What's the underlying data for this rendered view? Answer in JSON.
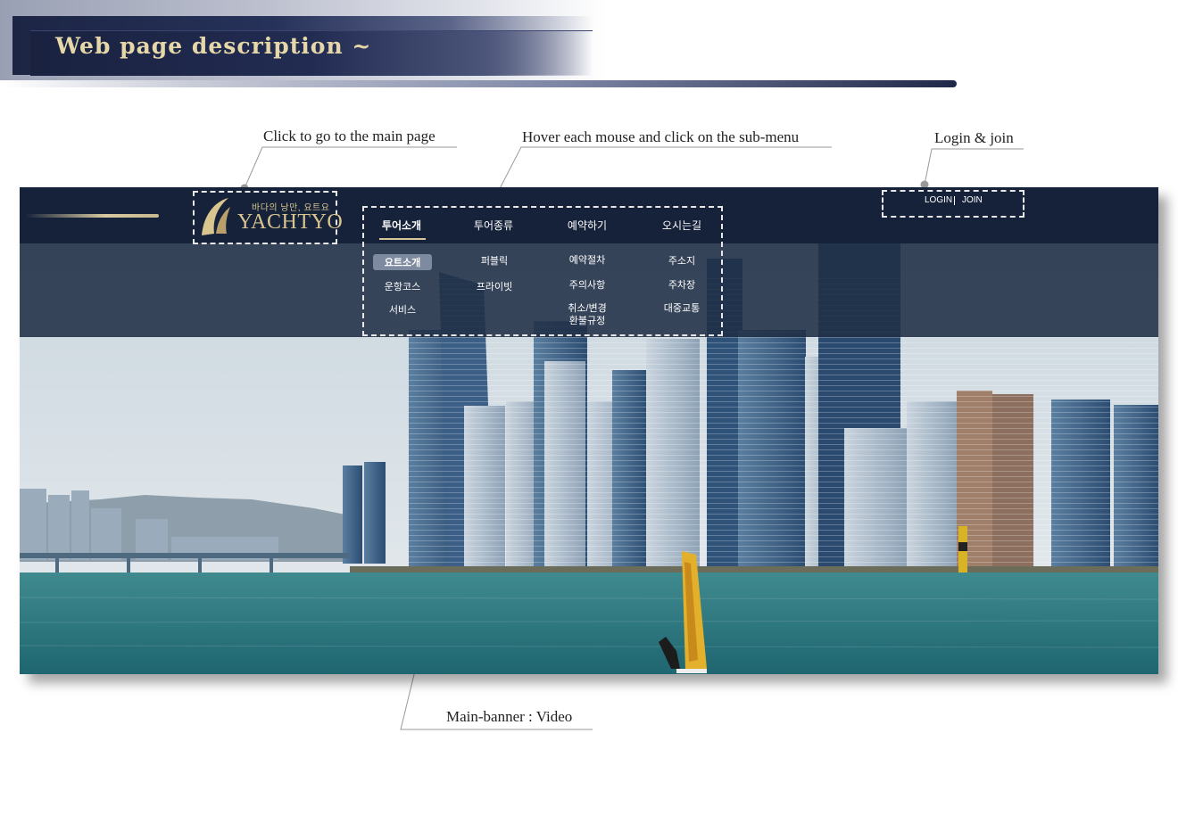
{
  "header": {
    "title": "Web page description ~"
  },
  "annotations": {
    "logo": "Click to go to the main page",
    "menu": "Hover each mouse and click on the sub-menu",
    "login": "Login & join",
    "banner": "Main-banner : Video"
  },
  "site": {
    "logo_tagline": "바다의 낭만, 요트요",
    "logo_name": "YACHTYO",
    "menu": [
      {
        "label": "투어소개",
        "sub": [
          "요트소개",
          "운항코스",
          "서비스"
        ]
      },
      {
        "label": "투어종류",
        "sub": [
          "퍼블릭",
          "프라이빗"
        ]
      },
      {
        "label": "예약하기",
        "sub": [
          "예약절차",
          "주의사항",
          "취소/변경\n환불규정"
        ]
      },
      {
        "label": "오시는길",
        "sub": [
          "주소지",
          "주차장",
          "대중교통"
        ]
      }
    ],
    "login": "LOGIN",
    "join": "JOIN"
  },
  "colors": {
    "nav": "#15223a",
    "gold": "#d9c58f",
    "header_navy": "#1c2544"
  }
}
